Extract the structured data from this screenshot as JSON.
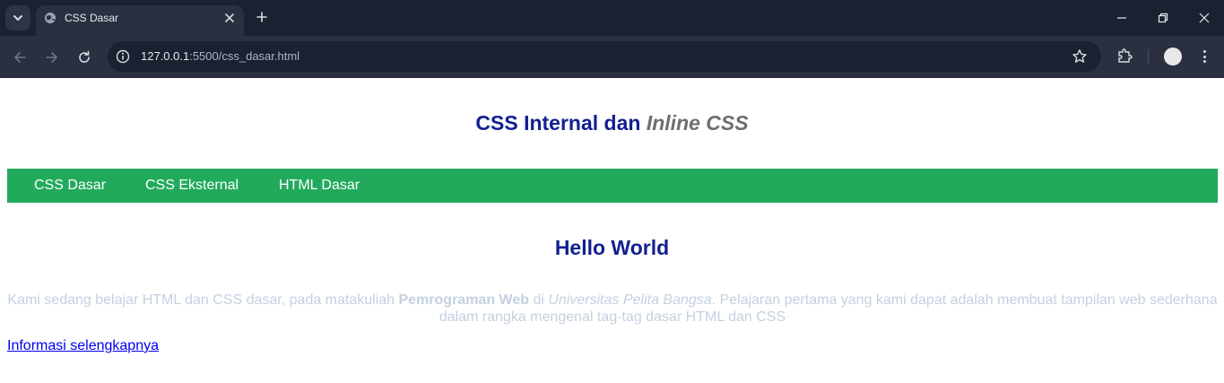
{
  "browser": {
    "tab_title": "CSS Dasar",
    "url_host": "127.0.0.1",
    "url_path": ":5500/css_dasar.html"
  },
  "page": {
    "title_main": "CSS Internal dan ",
    "title_em": "Inline CSS",
    "nav": [
      "CSS Dasar",
      "CSS Eksternal",
      "HTML Dasar"
    ],
    "heading": "Hello World",
    "para_1": "Kami sedang belajar HTML dan CSS dasar, pada matakuliah ",
    "para_bold": "Pemrograman Web",
    "para_2": " di ",
    "para_italic": "Universitas Pelita Bangsa",
    "para_3": ". Pelajaran pertama yang kami dapat adalah membuat tampilan web sederhana dalam rangka mengenal tag-tag dasar HTML dan CSS",
    "link": "Informasi selengkapnya"
  },
  "colors": {
    "heading": "#12208f",
    "nav_bg": "#22aa5c",
    "paragraph": "#c4d0e0",
    "link": "#0000ee"
  }
}
